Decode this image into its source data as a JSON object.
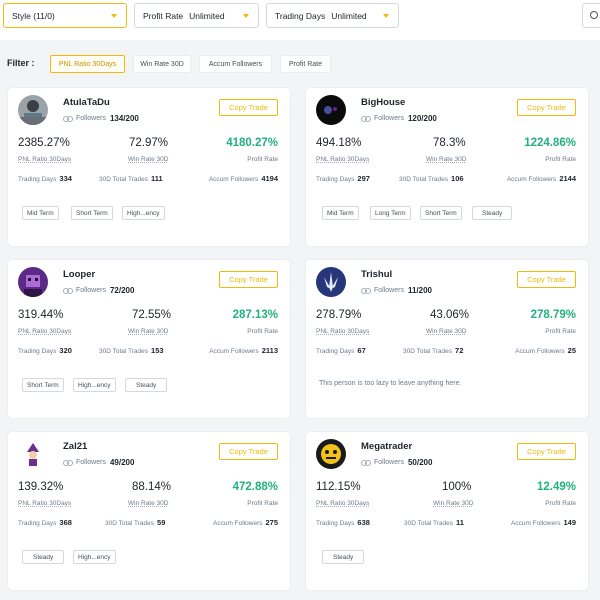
{
  "filters": {
    "style": {
      "label": "Style (11/0)"
    },
    "profit_rate": {
      "label": "Profit Rate",
      "value": "Unlimited"
    },
    "trading_days": {
      "label": "Trading Days",
      "value": "Unlimited"
    }
  },
  "filter_row": {
    "label": "Filter :",
    "chips": [
      {
        "label": "PNL Ratio 30Days",
        "active": true
      },
      {
        "label": "Win Rate 30D",
        "active": false
      },
      {
        "label": "Accum Followers",
        "active": false
      },
      {
        "label": "Profit Rate",
        "active": false
      }
    ]
  },
  "labels": {
    "followers": "Followers",
    "pnl_ratio": "PNL Ratio 30Days",
    "win_rate": "Win Rate 30D",
    "profit_rate": "Profit Rate",
    "trading_days": "Trading Days",
    "total_trades": "30D Total Trades",
    "accum_followers": "Accum Followers",
    "copy_trade": "Copy Trade"
  },
  "colors": {
    "accent": "#f0b90b",
    "positive": "#22b07d"
  },
  "traders": [
    {
      "name": "AtulaTaDu",
      "followers": "134/200",
      "pnl": "2385.27%",
      "win_rate": "72.97%",
      "profit": "4180.27%",
      "trading_days": "334",
      "total_trades": "111",
      "accum_followers": "4194",
      "tags": [
        "Mid Term",
        "Short Term",
        "High...ency"
      ],
      "bio": ""
    },
    {
      "name": "BigHouse",
      "followers": "120/200",
      "pnl": "494.18%",
      "win_rate": "78.3%",
      "profit": "1224.86%",
      "trading_days": "297",
      "total_trades": "106",
      "accum_followers": "2144",
      "tags": [
        "Mid Term",
        "Long Term",
        "Short Term",
        "Steady"
      ],
      "bio": ""
    },
    {
      "name": "Looper",
      "followers": "72/200",
      "pnl": "319.44%",
      "win_rate": "72.55%",
      "profit": "287.13%",
      "trading_days": "320",
      "total_trades": "153",
      "accum_followers": "2113",
      "tags": [
        "Short Term",
        "High...ency",
        "Steady"
      ],
      "bio": ""
    },
    {
      "name": "Trishul",
      "followers": "11/200",
      "pnl": "278.79%",
      "win_rate": "43.06%",
      "profit": "278.79%",
      "trading_days": "67",
      "total_trades": "72",
      "accum_followers": "25",
      "tags": [],
      "bio": "This person is too lazy to leave anything here."
    },
    {
      "name": "Zal21",
      "followers": "49/200",
      "pnl": "139.32%",
      "win_rate": "88.14%",
      "profit": "472.88%",
      "trading_days": "368",
      "total_trades": "59",
      "accum_followers": "275",
      "tags": [
        "Steady",
        "High...ency"
      ],
      "bio": ""
    },
    {
      "name": "Megatrader",
      "followers": "50/200",
      "pnl": "112.15%",
      "win_rate": "100%",
      "profit": "12.49%",
      "trading_days": "638",
      "total_trades": "11",
      "accum_followers": "149",
      "tags": [
        "Steady"
      ],
      "bio": ""
    }
  ]
}
